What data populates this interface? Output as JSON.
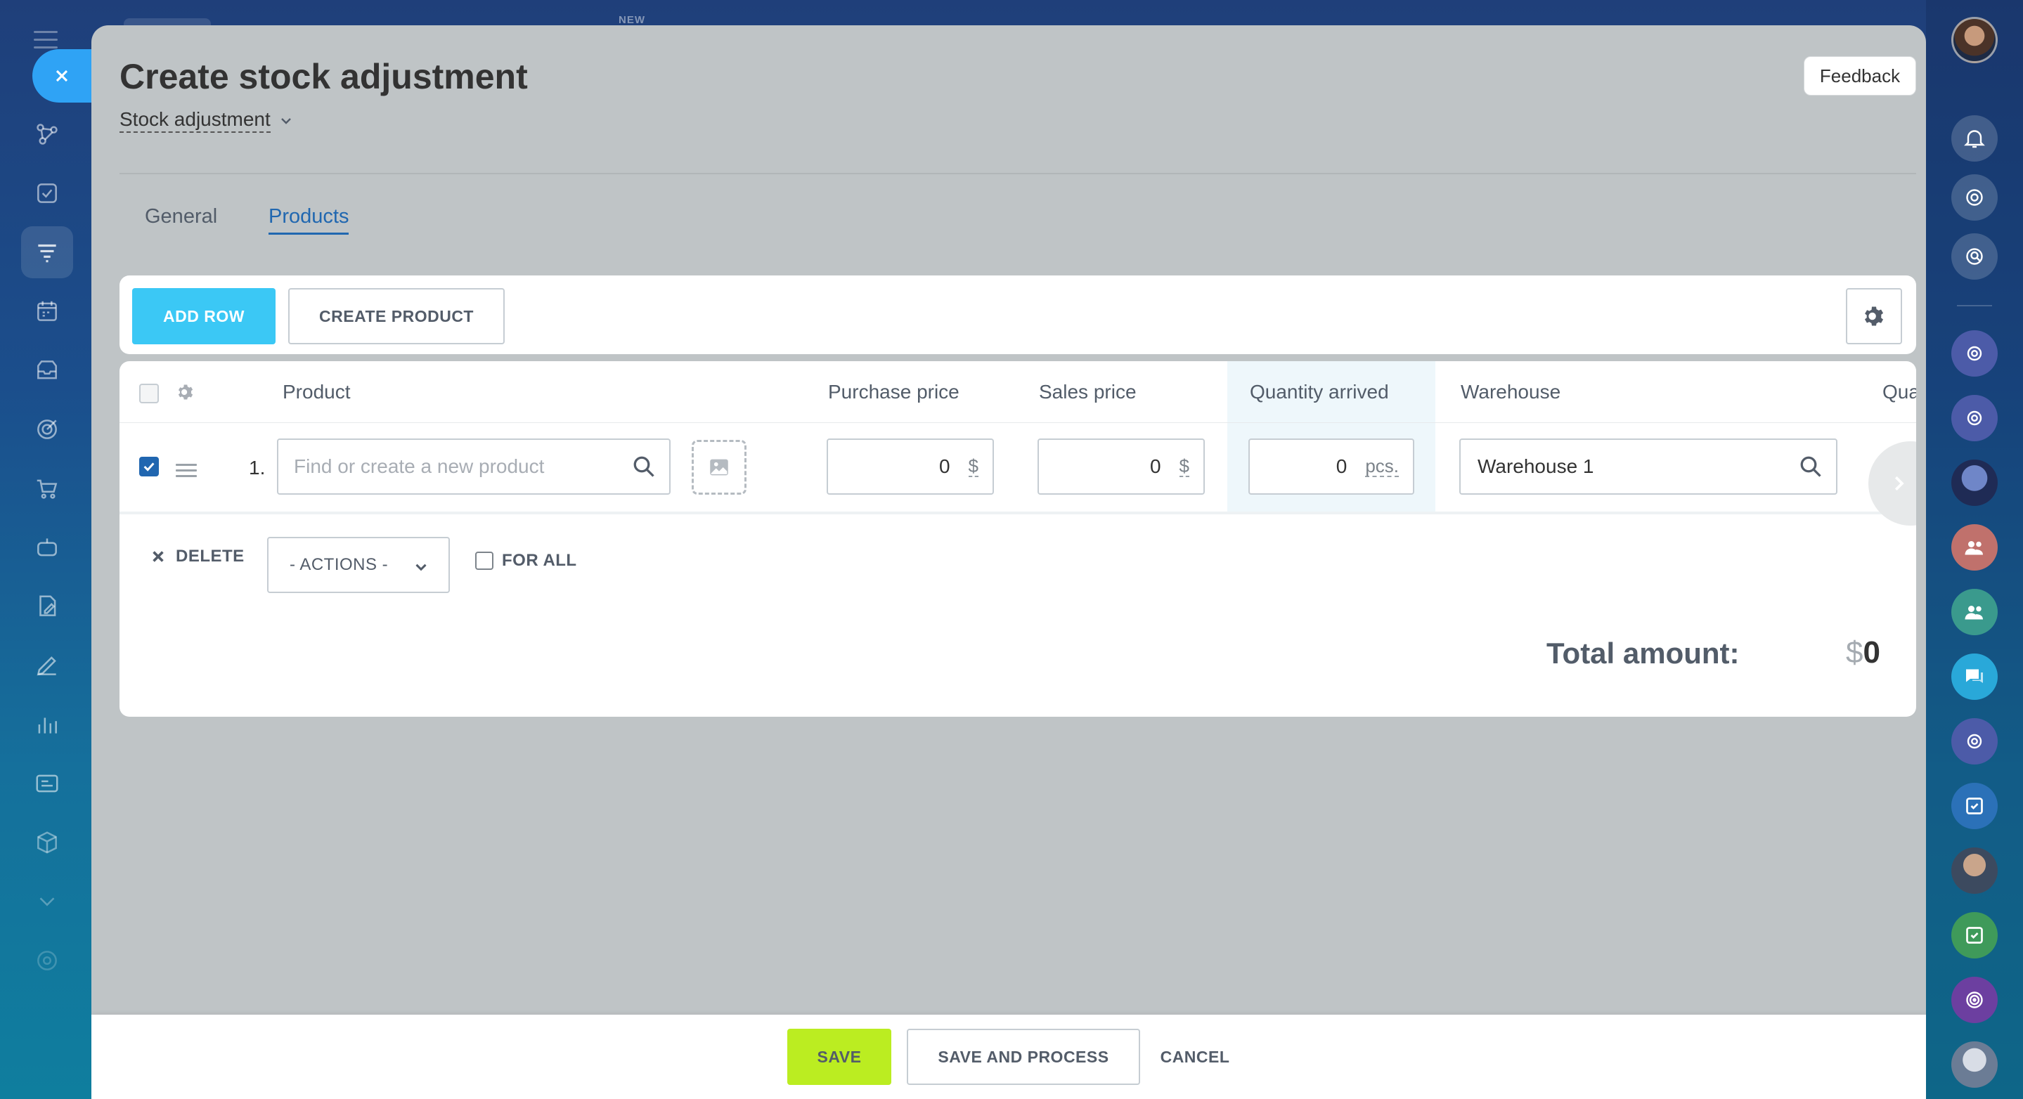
{
  "top": {
    "new_label": "NEW"
  },
  "panel": {
    "title": "Create stock adjustment",
    "subtitle": "Stock adjustment",
    "feedback_label": "Feedback"
  },
  "tabs": [
    {
      "label": "General",
      "active": false
    },
    {
      "label": "Products",
      "active": true
    }
  ],
  "toolbar": {
    "add_row_label": "ADD ROW",
    "create_product_label": "CREATE PRODUCT"
  },
  "grid": {
    "columns": [
      "Product",
      "Purchase price",
      "Sales price",
      "Quantity arrived",
      "Warehouse",
      "Qua"
    ],
    "rows": [
      {
        "number": "1.",
        "checked": true,
        "product_placeholder": "Find or create a new product",
        "purchase_price": "0",
        "purchase_currency": "$",
        "sales_price": "0",
        "sales_currency": "$",
        "quantity": "0",
        "quantity_unit": "pcs.",
        "warehouse": "Warehouse 1"
      }
    ],
    "delete_label": "DELETE",
    "actions_label": "- ACTIONS -",
    "for_all_label": "FOR ALL",
    "total_label": "Total amount:",
    "total_currency": "$",
    "total_value": "0"
  },
  "footer": {
    "save_label": "SAVE",
    "save_and_process_label": "SAVE AND PROCESS",
    "cancel_label": "CANCEL"
  },
  "colors": {
    "accent_blue": "#3bc8f5",
    "save_green": "#bbed21",
    "tab_active": "#2067b0",
    "close_button": "#2fa3f5"
  },
  "icons": {
    "left_nav": [
      "workflow-icon",
      "task-icon",
      "filter-icon",
      "calendar-icon",
      "inbox-icon",
      "target-icon",
      "cart-icon",
      "robot-icon",
      "document-edit-icon",
      "pen-icon",
      "chart-icon",
      "contact-card-icon",
      "box-icon",
      "chevron-down-icon",
      "settings-icon"
    ],
    "right_bar": [
      "bell-icon",
      "copilot-icon",
      "search-chat-icon",
      "channel-icon",
      "channel-icon",
      "user-avatar",
      "group-icon",
      "group-icon",
      "chat-icon",
      "channel-icon",
      "task-icon",
      "user-avatar",
      "task-icon",
      "fingerprint-icon",
      "user-avatar"
    ]
  }
}
